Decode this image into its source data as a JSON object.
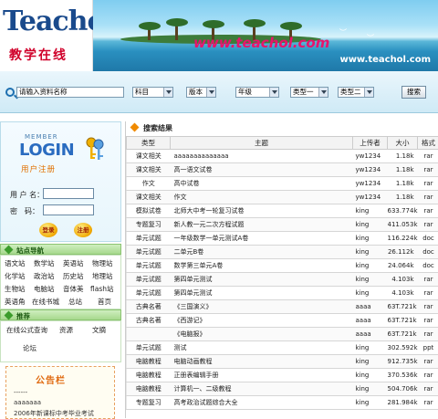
{
  "header": {
    "logo_text": "Teachol",
    "logo_subtitle": "教学在线",
    "banner_site_text": "www.teachol.com",
    "banner_url": "www.teachol.com"
  },
  "search": {
    "input_value": "请输入资料名称",
    "selects": [
      "科目",
      "版本",
      "年级",
      "类型一",
      "类型二"
    ],
    "button_label": "搜索"
  },
  "login": {
    "member_text": "MEMBER",
    "title": "LOGIN",
    "register_text": "用户注册",
    "username_label": "用 户 名：",
    "password_label": "密　码：",
    "login_button": "登录",
    "register_button": "注册"
  },
  "site_nav": {
    "title": "站点导航",
    "items": [
      "语文站",
      "数学站",
      "英语站",
      "物理站",
      "化学站",
      "政治站",
      "历史站",
      "地理站",
      "生物站",
      "电脑站",
      "音体美",
      "flash站",
      "英语角",
      "在线书城",
      "总站",
      "首页"
    ]
  },
  "recommend": {
    "title": "推荐",
    "items": [
      "在线公式查询",
      "资源",
      "文摘",
      "论坛"
    ]
  },
  "notice": {
    "title": "公告栏",
    "lines": [
      "------",
      "aaaaaaa",
      "2006年新课标中考毕业考试"
    ]
  },
  "results": {
    "title": "搜索结果",
    "columns": [
      "类型",
      "主题",
      "上传者",
      "大小",
      "格式"
    ],
    "rows": [
      [
        "课文相关",
        "aaaaaaaaaaaaaa",
        "yw1234",
        "1.18k",
        "rar"
      ],
      [
        "课文相关",
        "高一语文试卷",
        "yw1234",
        "1.18k",
        "rar"
      ],
      [
        "作文",
        "高中试卷",
        "yw1234",
        "1.18k",
        "rar"
      ],
      [
        "课文相关",
        "作文",
        "yw1234",
        "1.18k",
        "rar"
      ],
      [
        "模拟试卷",
        "北师大中考一轮复习试卷",
        "king",
        "633.774k",
        "rar"
      ],
      [
        "专题复习",
        "新人教一元二次方程试题",
        "king",
        "411.053k",
        "rar"
      ],
      [
        "单元试题",
        "一年级数学一单元测试A卷",
        "king",
        "116.224k",
        "doc"
      ],
      [
        "单元试题",
        "二单元B卷",
        "king",
        "26.112k",
        "doc"
      ],
      [
        "单元试题",
        "数学第三单元A卷",
        "king",
        "24.064k",
        "doc"
      ],
      [
        "单元试题",
        "第四单元测试",
        "king",
        "4.103k",
        "rar"
      ],
      [
        "单元试题",
        "第四单元测试",
        "king",
        "4.103k",
        "rar"
      ],
      [
        "古典名著",
        "《三国演义》",
        "aaaa",
        "63T.721k",
        "rar"
      ],
      [
        "古典名著",
        "《西游记》",
        "aaaa",
        "63T.721k",
        "rar"
      ],
      [
        "",
        "《电脑报》",
        "aaaa",
        "63T.721k",
        "rar"
      ],
      [
        "单元试题",
        "测试",
        "king",
        "302.592k",
        "ppt"
      ],
      [
        "电脑教程",
        "电脑动画教程",
        "king",
        "912.735k",
        "rar"
      ],
      [
        "电脑教程",
        "正册表编辑手册",
        "king",
        "370.536k",
        "rar"
      ],
      [
        "电脑教程",
        "计算机一、二级教程",
        "king",
        "504.706k",
        "rar"
      ],
      [
        "专题复习",
        "高考政治试题综合大全",
        "king",
        "281.984k",
        "rar"
      ]
    ]
  },
  "colors": {
    "accent_blue": "#2a6cc0",
    "section_green": "#a7d98e",
    "notice_orange": "#e06a10"
  }
}
